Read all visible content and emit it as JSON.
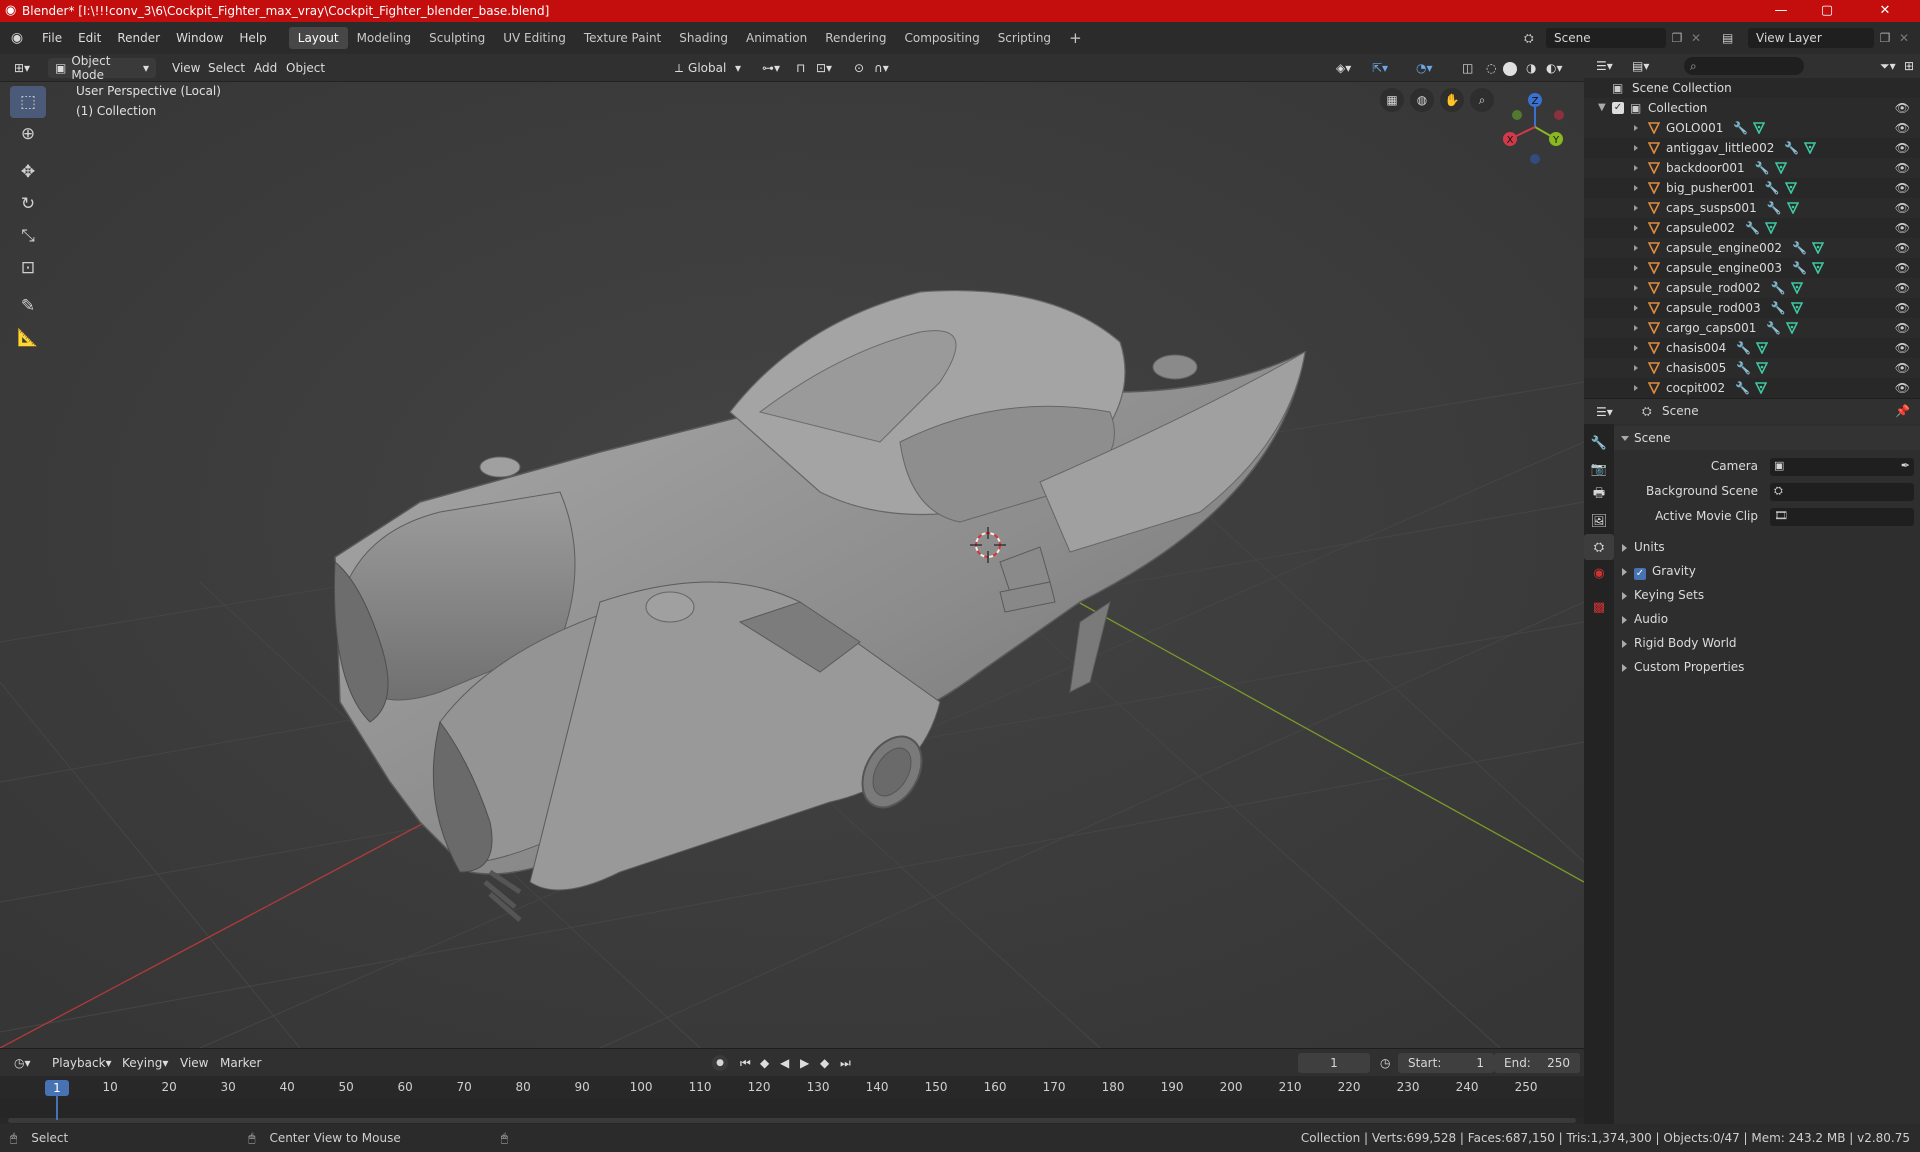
{
  "window": {
    "title": "Blender* [I:\\!!!conv_3\\6\\Cockpit_Fighter_max_vray\\Cockpit_Fighter_blender_base.blend]",
    "minimize": "—",
    "maximize": "▢",
    "close": "✕"
  },
  "menu": [
    "File",
    "Edit",
    "Render",
    "Window",
    "Help"
  ],
  "workspaces": [
    "Layout",
    "Modeling",
    "Sculpting",
    "UV Editing",
    "Texture Paint",
    "Shading",
    "Animation",
    "Rendering",
    "Compositing",
    "Scripting"
  ],
  "active_workspace": "Layout",
  "add_workspace": "+",
  "scene_selector": {
    "label": "Scene"
  },
  "viewlayer_selector": {
    "label": "View Layer"
  },
  "viewport_header": {
    "mode": "Object Mode",
    "menus": [
      "View",
      "Select",
      "Add",
      "Object"
    ],
    "transform_orientation": "Global"
  },
  "viewport": {
    "perspective": "User Perspective (Local)",
    "collection": "(1) Collection",
    "gizmo": {
      "x": "X",
      "y": "Y",
      "z": "Z"
    }
  },
  "outliner": {
    "search_placeholder": "",
    "root": "Scene Collection",
    "collection": "Collection",
    "items": [
      "GOLO001",
      "antiggav_little002",
      "backdoor001",
      "big_pusher001",
      "caps_susps001",
      "capsule002",
      "capsule_engine002",
      "capsule_engine003",
      "capsule_rod002",
      "capsule_rod003",
      "cargo_caps001",
      "chasis004",
      "chasis005",
      "cocpit002"
    ]
  },
  "properties": {
    "header": "Scene",
    "panel": "Scene",
    "fields": [
      {
        "label": "Camera",
        "value": ""
      },
      {
        "label": "Background Scene",
        "value": ""
      },
      {
        "label": "Active Movie Clip",
        "value": ""
      }
    ],
    "sections": [
      "Units",
      "Gravity",
      "Keying Sets",
      "Audio",
      "Rigid Body World",
      "Custom Properties"
    ],
    "gravity_checked": true
  },
  "timeline": {
    "menus": [
      "Playback",
      "Keying",
      "View",
      "Marker"
    ],
    "current_frame": "1",
    "start_label": "Start:",
    "start": "1",
    "end_label": "End:",
    "end": "250",
    "ticks": [
      "1",
      "10",
      "20",
      "30",
      "40",
      "50",
      "60",
      "70",
      "80",
      "90",
      "100",
      "110",
      "120",
      "130",
      "140",
      "150",
      "160",
      "170",
      "180",
      "190",
      "200",
      "210",
      "220",
      "230",
      "240",
      "250"
    ]
  },
  "statusbar": {
    "select": "Select",
    "center": "Center View to Mouse",
    "stats": "Collection | Verts:699,528 | Faces:687,150 | Tris:1,374,300 | Objects:0/47 | Mem: 243.2 MB | v2.80.75"
  },
  "colors": {
    "titlebar": "#c40d0d",
    "accent": "#4772b3",
    "mesh_orange": "#e08c3c",
    "modifier_blue": "#6aa8e8",
    "mesh_green": "#3ec7a0"
  }
}
